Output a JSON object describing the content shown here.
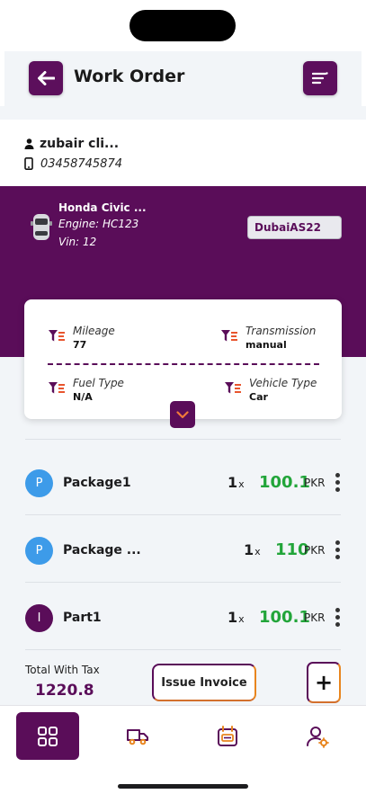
{
  "header": {
    "title": "Work Order"
  },
  "client": {
    "name": "zubair cli...",
    "phone": "03458745874"
  },
  "vehicle": {
    "name": "Honda Civic ...",
    "engine": "Engine: HC123",
    "vin": "Vin: 12",
    "plate": "DubaiAS22"
  },
  "details": {
    "mileage": {
      "label": "Mileage",
      "value": "77"
    },
    "transmission": {
      "label": "Transmission",
      "value": "manual"
    },
    "fuel_type": {
      "label": "Fuel Type",
      "value": "N/A"
    },
    "vehicle_type": {
      "label": "Vehicle Type",
      "value": "Car"
    }
  },
  "items": [
    {
      "initial": "P",
      "kind": "package",
      "name": "Package1",
      "qty": "1",
      "qty_suffix": "x",
      "price": "100.1",
      "currency": "PKR"
    },
    {
      "initial": "P",
      "kind": "package",
      "name": "Package ...",
      "qty": "1",
      "qty_suffix": "x",
      "price": "110",
      "currency": "PKR"
    },
    {
      "initial": "I",
      "kind": "part",
      "name": "Part1",
      "qty": "1",
      "qty_suffix": "x",
      "price": "100.1",
      "currency": "PKR"
    }
  ],
  "totals": {
    "label": "Total With Tax",
    "value": "1220.8"
  },
  "actions": {
    "issue_invoice": "Issue Invoice",
    "add": "+"
  },
  "nav": {
    "items": [
      {
        "icon": "dashboard-grid-icon",
        "active": true
      },
      {
        "icon": "truck-icon",
        "active": false
      },
      {
        "icon": "invoice-icon",
        "active": false
      },
      {
        "icon": "user-settings-icon",
        "active": false
      }
    ]
  },
  "colors": {
    "primary": "#5a0d59",
    "accent_orange": "#e8851e",
    "price_green": "#22a53a",
    "package_blue": "#3d9be9"
  }
}
